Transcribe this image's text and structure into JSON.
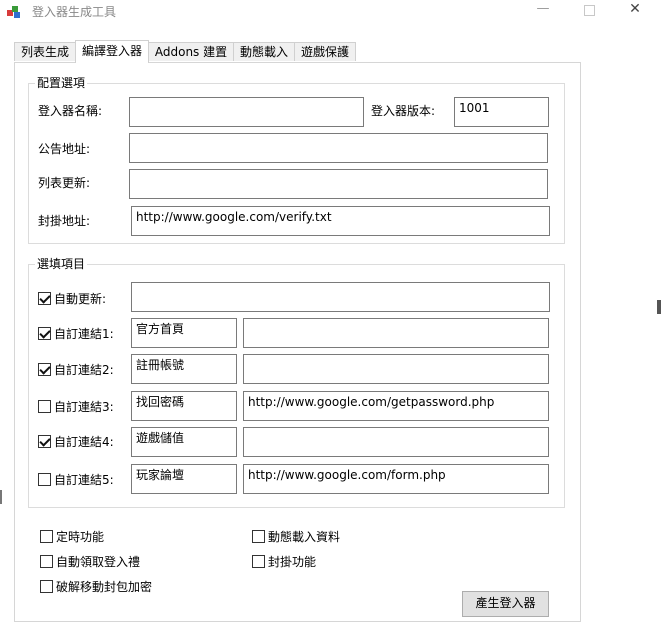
{
  "window": {
    "title": "登入器生成工具"
  },
  "tabs": [
    "列表生成",
    "編譯登入器",
    "Addons 建置",
    "動態載入",
    "遊戲保護"
  ],
  "config": {
    "title": "配置選項",
    "name_label": "登入器名稱:",
    "name_value": "",
    "version_label": "登入器版本:",
    "version_value": "1001",
    "notice_label": "公告地址:",
    "notice_value": "",
    "list_label": "列表更新:",
    "list_value": "",
    "block_label": "封掛地址:",
    "block_value": "http://www.google.com/verify.txt"
  },
  "options": {
    "title": "選填項目",
    "auto_update": {
      "label": "自動更新:",
      "checked": true,
      "value": ""
    },
    "links": [
      {
        "label": "自訂連結1:",
        "checked": true,
        "name": "官方首頁",
        "url": ""
      },
      {
        "label": "自訂連結2:",
        "checked": true,
        "name": "註冊帳號",
        "url": ""
      },
      {
        "label": "自訂連結3:",
        "checked": false,
        "name": "找回密碼",
        "url": "http://www.google.com/getpassword.php"
      },
      {
        "label": "自訂連結4:",
        "checked": true,
        "name": "遊戲儲值",
        "url": ""
      },
      {
        "label": "自訂連結5:",
        "checked": false,
        "name": "玩家論壇",
        "url": "http://www.google.com/form.php"
      }
    ]
  },
  "extras": {
    "timer": "定時功能",
    "dynamic": "動態載入資料",
    "auto_gift": "自動領取登入禮",
    "anti_hack": "封掛功能",
    "crack_encrypt": "破解移動封包加密"
  },
  "generate_button": "產生登入器"
}
